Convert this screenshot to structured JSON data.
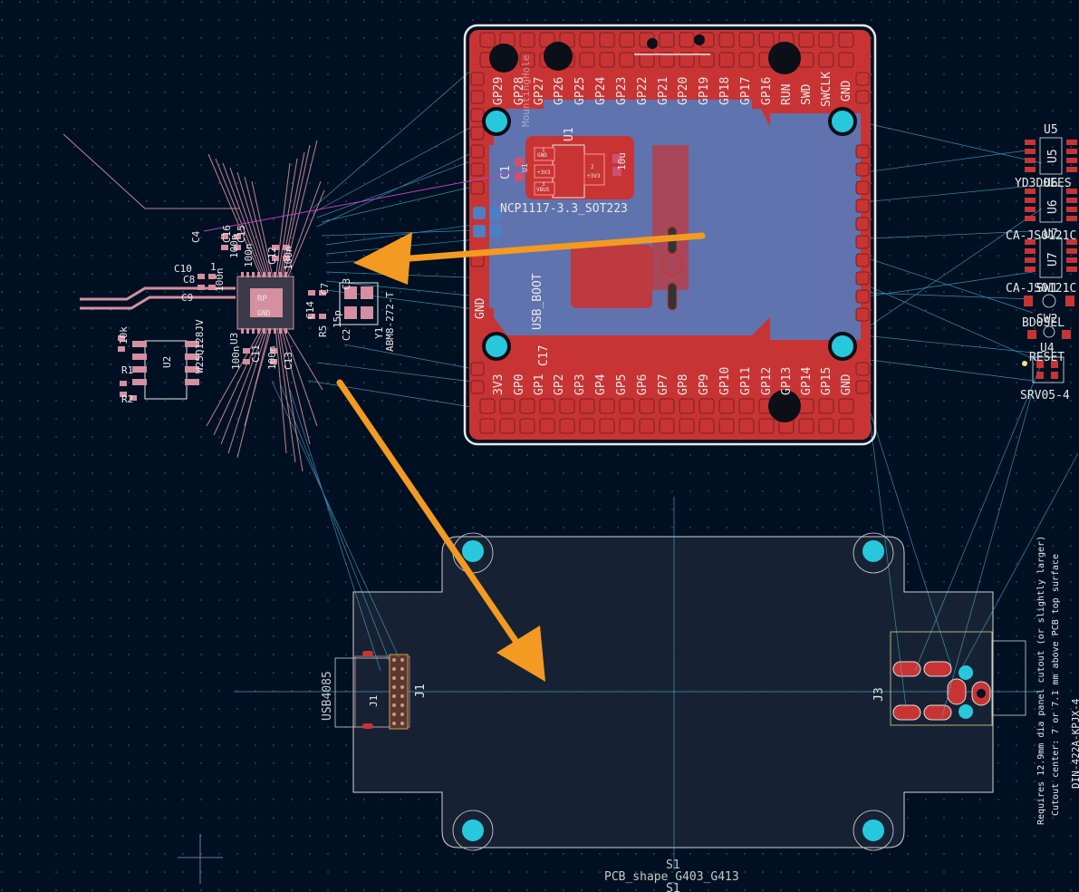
{
  "colors": {
    "background": "#001023",
    "grid": "#3a4a66",
    "front_copper": "#c83434",
    "back_copper": "#4d7fc4",
    "silkscreen": "#f2f2f2",
    "ratsnest": "#4fb6d9",
    "outline": "#d0d0d0",
    "arrow": "#f29a22",
    "via": "#28c8dc",
    "courtyard": "#d58fa0"
  },
  "module_board": {
    "top_pins": [
      "GP29",
      "GP28",
      "GP27",
      "GP26",
      "GP25",
      "GP24",
      "GP23",
      "GP22",
      "GP21",
      "GP20",
      "GP19",
      "GP18",
      "GP17",
      "GP16",
      "RUN",
      "SWD",
      "SWCLK",
      "GND"
    ],
    "bottom_pins": [
      "3V3",
      "GP0",
      "GP1",
      "GP2",
      "GP3",
      "GP4",
      "GP5",
      "GP6",
      "GP7",
      "GP8",
      "GP9",
      "GP10",
      "GP11",
      "GP12",
      "GP13",
      "GP14",
      "GP15",
      "GND"
    ],
    "labels": {
      "u1": "U1",
      "c1": "C1",
      "reg": "NCP1117-3.3_SOT223",
      "gnd": "GND",
      "usb_boot": "USB_BOOT",
      "c17": "C17",
      "mounting": "MountingHole",
      "cap_val": "10u",
      "u1_val": "U1",
      "reg_gnd": "GND",
      "reg_3v3": "+3V3",
      "reg_vbus": "VBUS",
      "reg_pin2": "+3V3",
      "pin1": "1",
      "pin2": "2",
      "pin3": "3"
    }
  },
  "left_cluster": {
    "labels": {
      "c4": "C4",
      "c16": "C16",
      "c15": "C15",
      "c12": "C12",
      "c10": "C10",
      "c8": "C8",
      "c9": "C9",
      "c7": "C7",
      "c3": "C3",
      "c2": "C2",
      "c11": "C11",
      "c13": "C13",
      "c14": "C14",
      "u3": "U3",
      "u2": "U2",
      "r1": "R1",
      "r2": "R2",
      "r5": "R5",
      "y1": "Y1",
      "y1_val": "ABM8-272-T",
      "flash": "W25Q128JV",
      "n100_a": "100n",
      "n100_b": "100n",
      "n100_c": "100n",
      "n100_d": "100n",
      "n100_e": "100n",
      "n100_f": "100n",
      "n15p": "15p",
      "r10k": "10k",
      "one": "1",
      "gnd": "GND",
      "rp": "RP"
    }
  },
  "right_parts": {
    "u5": "U5",
    "u5_side": "U5",
    "u6": "U6",
    "u6_label": "U6",
    "u7": "U7",
    "u7_label": "U7",
    "yd": "YD3D0EES",
    "ca1": "CA-JS0121C",
    "ca2": "CA-JS0121C",
    "sw1": "SW1",
    "sw2": "SW2",
    "bd": "BD0SEL",
    "u4": "U4",
    "reset": "RESET",
    "srv": "SRV05-4"
  },
  "enclosure": {
    "j1": "J1",
    "j1_silk": "J1",
    "usb": "USB4085",
    "j3": "J3",
    "s1_top": "S1",
    "shape": "PCB_shape_G403_G413",
    "s1_bottom": "S1",
    "note1": "Requires 12.9mm dia panel cutout (or slightly larger)",
    "note2": "Cutout center: 7 or 7.1 mm above PCB top surface",
    "din": "DIN-422A-KPJX-4"
  }
}
